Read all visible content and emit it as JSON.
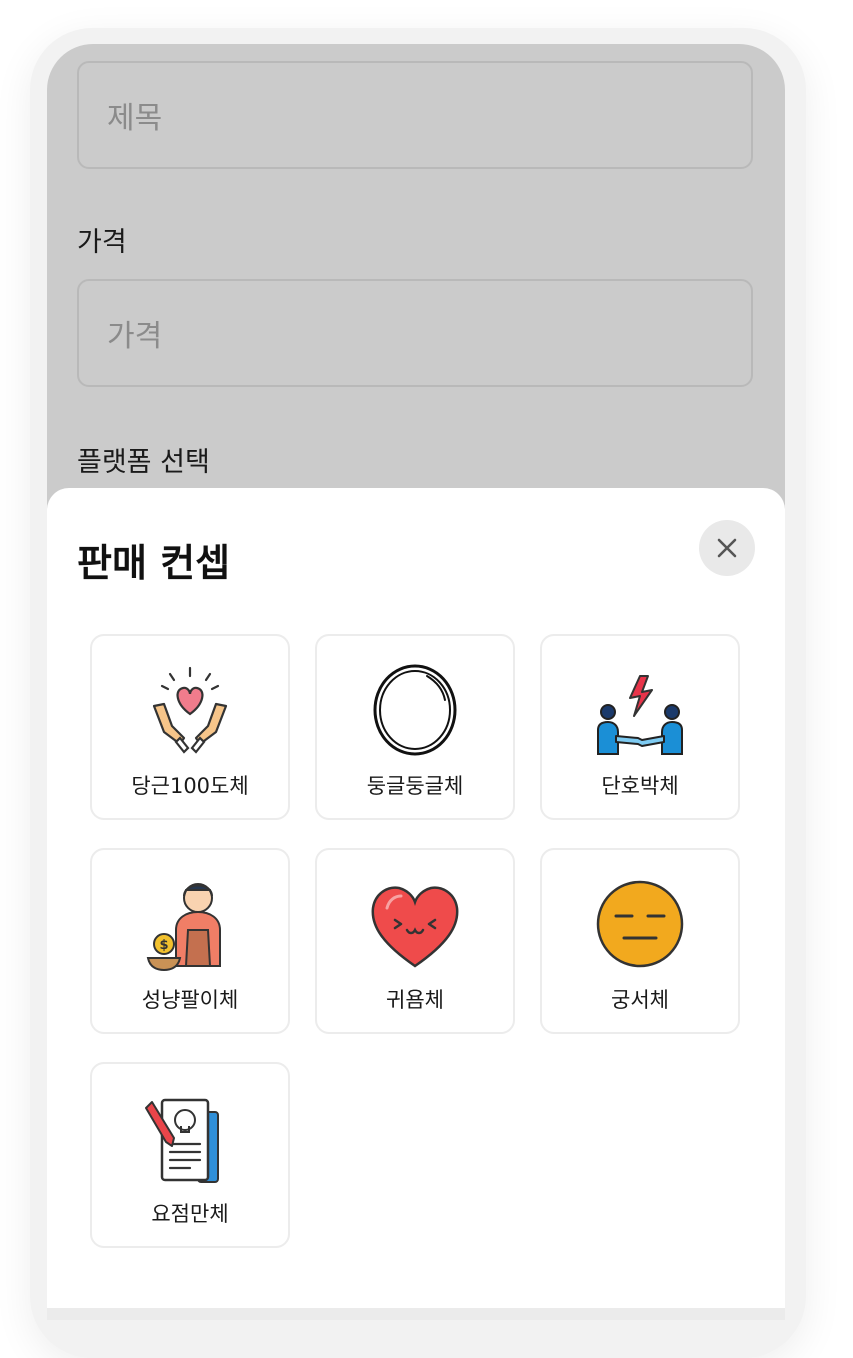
{
  "form": {
    "title_placeholder": "제목",
    "price_label": "가격",
    "price_placeholder": "가격",
    "platform_label": "플랫폼 선택"
  },
  "sheet": {
    "title": "판매 컨셉",
    "close_icon": "close-icon",
    "options": [
      {
        "label": "당근100도체",
        "icon": "heart-hands-icon"
      },
      {
        "label": "둥글둥글체",
        "icon": "circle-icon"
      },
      {
        "label": "단호박체",
        "icon": "conflict-handshake-icon"
      },
      {
        "label": "성냥팔이체",
        "icon": "beggar-icon"
      },
      {
        "label": "귀욤체",
        "icon": "cute-heart-icon"
      },
      {
        "label": "궁서체",
        "icon": "neutral-face-icon"
      },
      {
        "label": "요점만체",
        "icon": "idea-document-icon"
      }
    ]
  },
  "colors": {
    "overlay": "#cbcbcb",
    "sheet_bg": "#ffffff",
    "heart_red": "#ef4b4b",
    "face_yellow": "#f2a91e",
    "person_blue": "#1b8fd6"
  }
}
